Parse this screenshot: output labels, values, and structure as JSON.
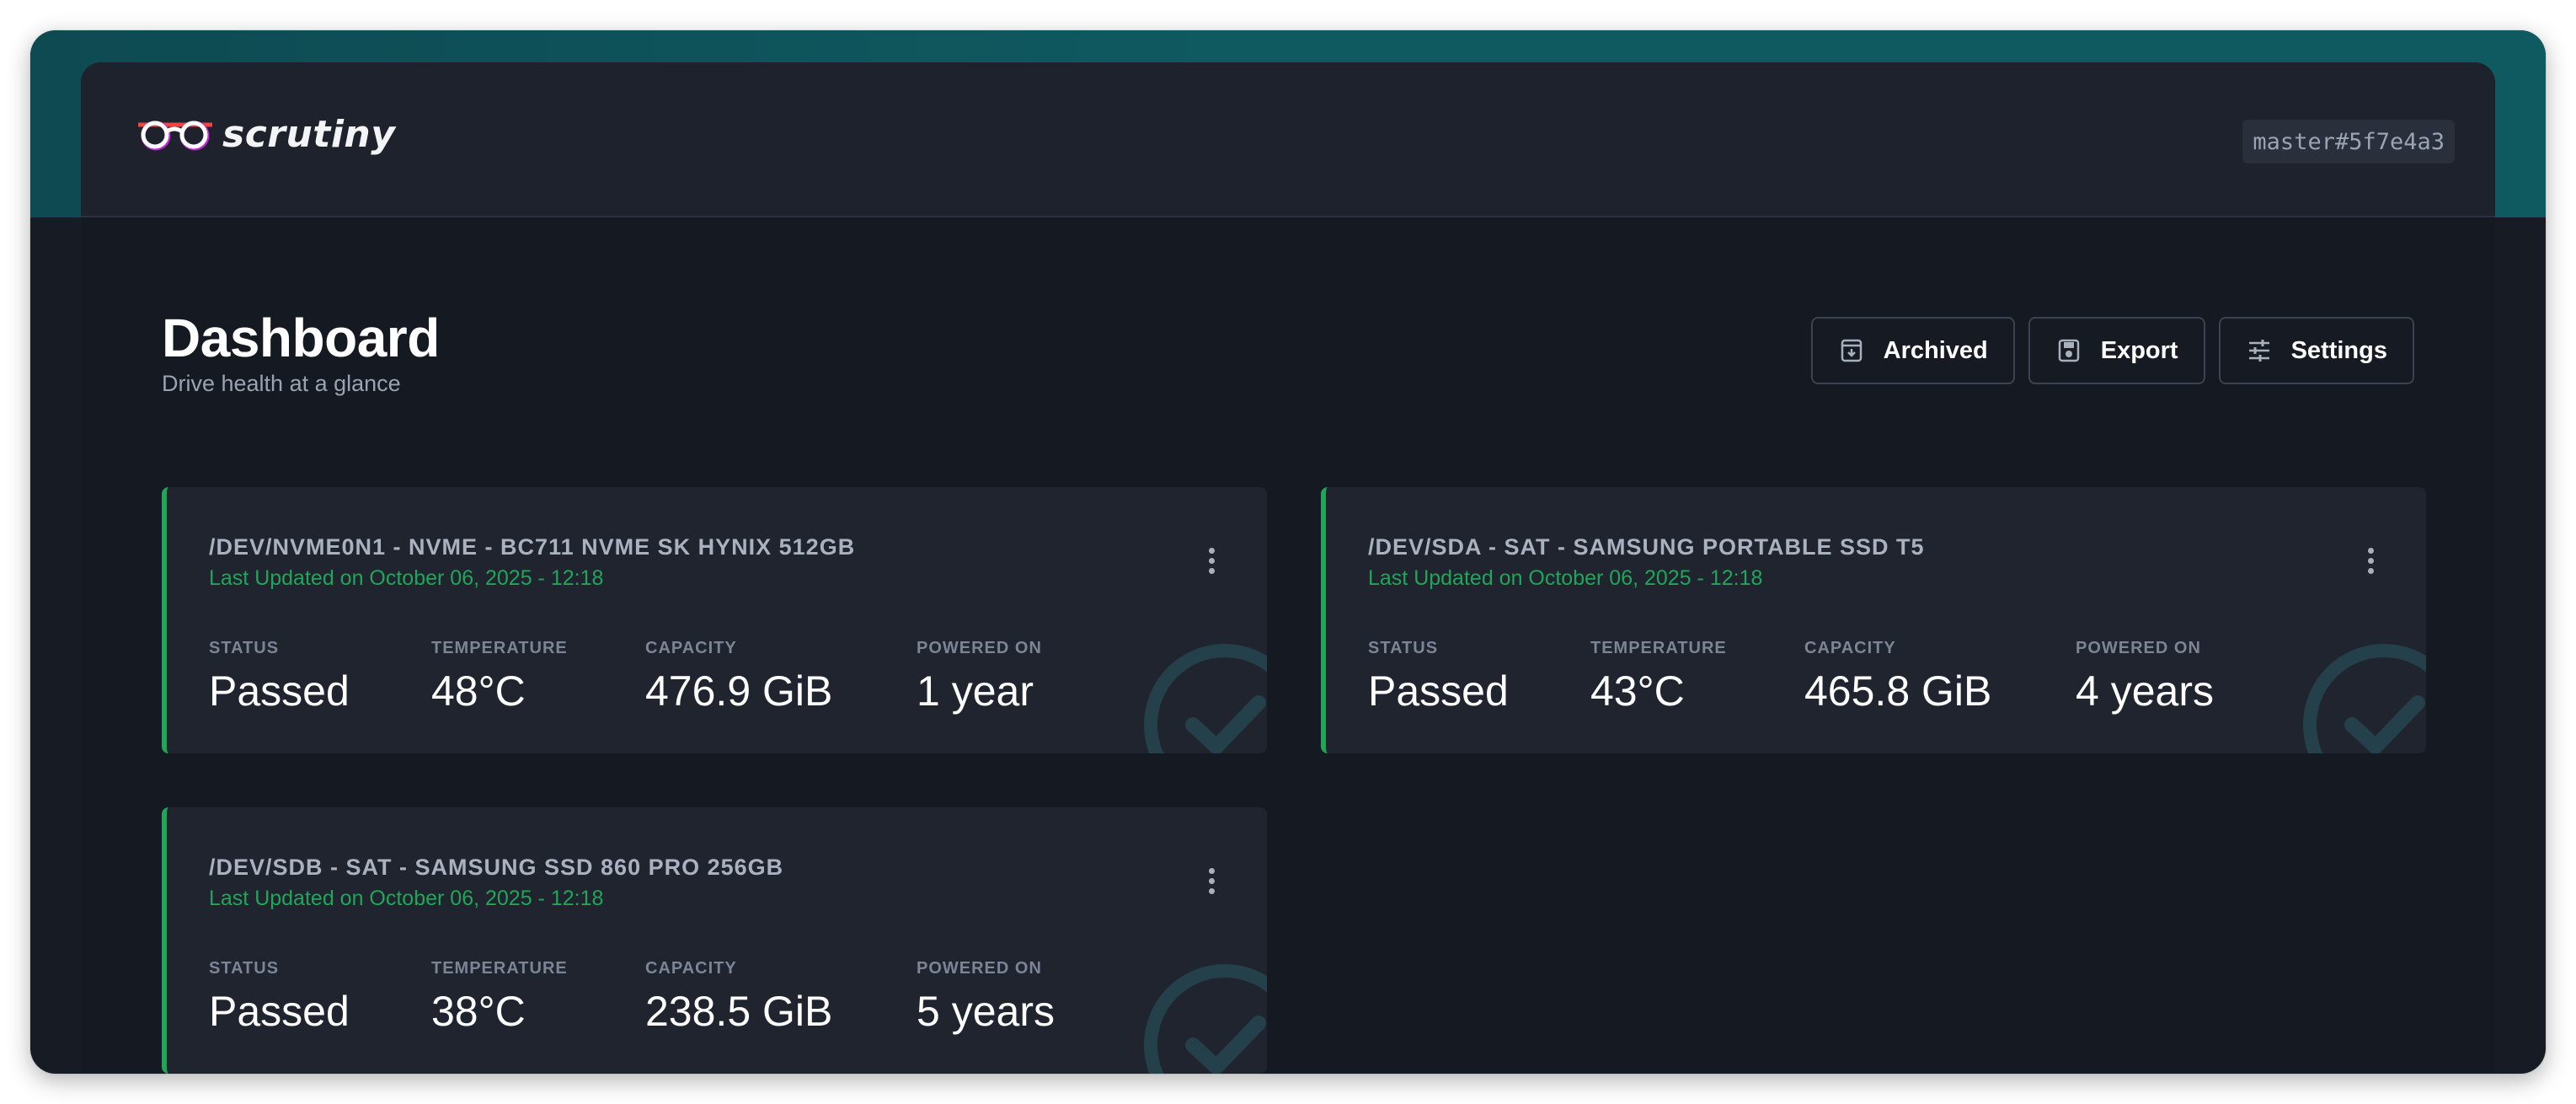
{
  "app": {
    "name": "scrutiny",
    "version": "master#5f7e4a3"
  },
  "page": {
    "title": "Dashboard",
    "subtitle": "Drive health at a glance"
  },
  "actions": {
    "archived": "Archived",
    "export": "Export",
    "settings": "Settings"
  },
  "labels": {
    "status": "Status",
    "temperature": "Temperature",
    "capacity": "Capacity",
    "powered_on": "Powered On"
  },
  "drives": [
    {
      "title": "/dev/nvme0n1 - nvme - BC711 NVMe SK hynix 512GB",
      "updated": "Last Updated on October 06, 2025 - 12:18",
      "status": "Passed",
      "temperature": "48°C",
      "capacity": "476.9 GiB",
      "powered_on": "1 year"
    },
    {
      "title": "/dev/sda - sat - Samsung Portable SSD T5",
      "updated": "Last Updated on October 06, 2025 - 12:18",
      "status": "Passed",
      "temperature": "43°C",
      "capacity": "465.8 GiB",
      "powered_on": "4 years"
    },
    {
      "title": "/dev/sdb - sat - Samsung SSD 860 PRO 256GB",
      "updated": "Last Updated on October 06, 2025 - 12:18",
      "status": "Passed",
      "temperature": "38°C",
      "capacity": "238.5 GiB",
      "powered_on": "5 years"
    }
  ],
  "colors": {
    "accent_teal": "#0f5a61",
    "status_ok": "#22a559",
    "background": "#151922",
    "card": "#1f242f"
  }
}
